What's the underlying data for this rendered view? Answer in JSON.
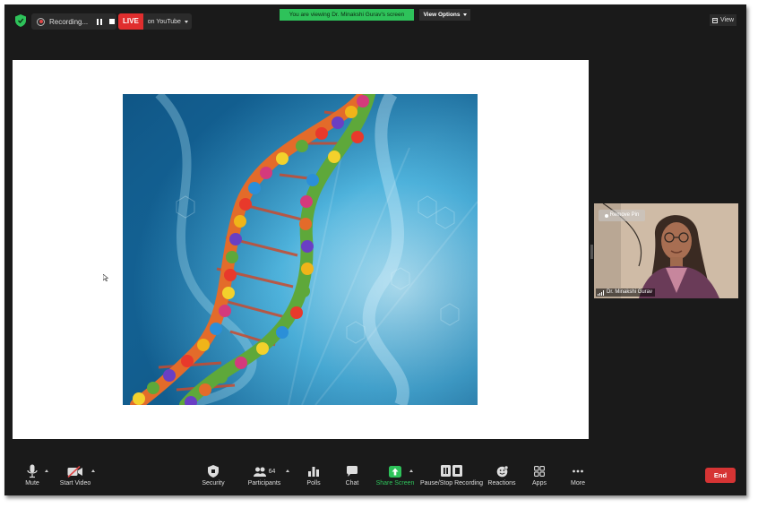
{
  "topbar": {
    "recording_text": "Recording...",
    "live_badge": "LIVE",
    "live_text": "on YouTube",
    "viewing_banner": "You are viewing Dr. Minakshi Gurav's screen",
    "view_options": "View Options",
    "view_button": "View"
  },
  "video_tile": {
    "remove_pin": "Remove Pin",
    "participant_name": "Dr. Minakshi Gurav"
  },
  "toolbar": {
    "mute": "Mute",
    "start_video": "Start Video",
    "security": "Security",
    "participants": "Participants",
    "participants_count": "64",
    "polls": "Polls",
    "chat": "Chat",
    "share_screen": "Share Screen",
    "pause_stop_recording": "Pause/Stop Recording",
    "reactions": "Reactions",
    "apps": "Apps",
    "more": "More",
    "end": "End"
  },
  "icons": {
    "security": "shield-icon",
    "mute": "microphone-icon",
    "start_video": "video-off-icon",
    "participants": "people-icon",
    "polls": "bar-chart-icon",
    "chat": "chat-bubble-icon",
    "share_screen": "share-arrow-icon",
    "pause_stop_recording": "pause-stop-icon",
    "reactions": "smiley-icon",
    "apps": "apps-icon",
    "more": "ellipsis-icon"
  },
  "colors": {
    "window_bg": "#1a1a1a",
    "viewing_banner": "#2ec25a",
    "share_screen_green": "#2ec25a",
    "live_red": "#e02e2e",
    "end_red": "#d63434",
    "security_shield": "#2ec25a"
  }
}
